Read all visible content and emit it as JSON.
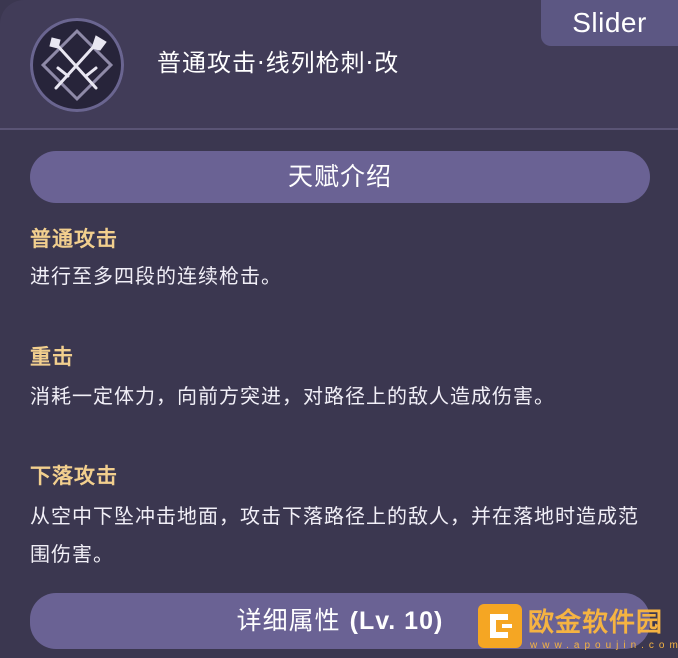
{
  "header": {
    "slider_label": "Slider",
    "skill_title": "普通攻击·线列枪刺·改",
    "skill_icon": "crossed-spear-icon"
  },
  "talent_section": {
    "label": "天赋介绍"
  },
  "entries": [
    {
      "title": "普通攻击",
      "text": "进行至多四段的连续枪击。"
    },
    {
      "title": "重击",
      "text": "消耗一定体力，向前方突进，对路径上的敌人造成伤害。"
    },
    {
      "title": "下落攻击",
      "text": "从空中下坠冲击地面，攻击下落路径上的敌人，并在落地时造成范围伤害。"
    }
  ],
  "detail_section": {
    "label": "详细属性",
    "level": "(Lv. 10)"
  },
  "watermark": {
    "name": "欧金软件园",
    "url": "www.apoujin.com",
    "logo_icon": "bracket-logo-icon"
  },
  "colors": {
    "background": "#3b3750",
    "bar": "#6a6294",
    "entry_title": "#f2cf8e",
    "slider_tag": "#5c5783"
  }
}
